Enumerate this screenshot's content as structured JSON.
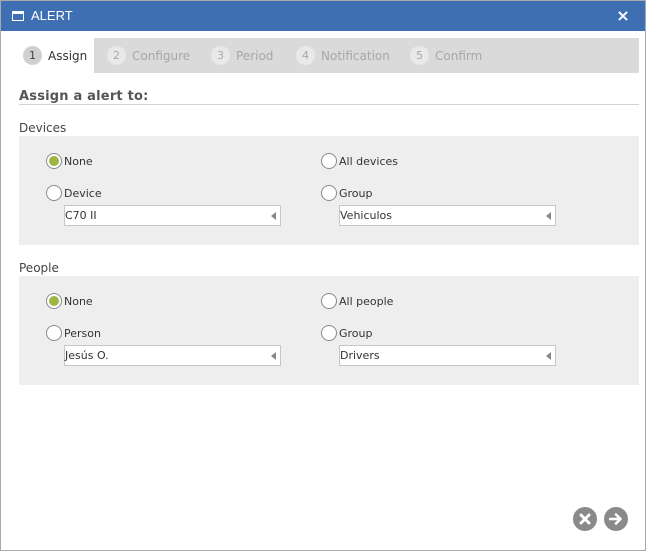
{
  "window": {
    "title": "ALERT",
    "icon": "window-icon",
    "close_icon": "close-icon",
    "close_glyph": "×"
  },
  "steps": [
    {
      "num": "1",
      "label": "Assign",
      "active": true
    },
    {
      "num": "2",
      "label": "Configure",
      "active": false
    },
    {
      "num": "3",
      "label": "Period",
      "active": false
    },
    {
      "num": "4",
      "label": "Notification",
      "active": false
    },
    {
      "num": "5",
      "label": "Confirm",
      "active": false
    }
  ],
  "heading": "Assign a alert to:",
  "devices": {
    "title": "Devices",
    "none_label": "None",
    "all_label": "All devices",
    "device_label": "Device",
    "group_label": "Group",
    "selected": "none",
    "device_value": "C70 II",
    "group_value": "Vehiculos"
  },
  "people": {
    "title": "People",
    "none_label": "None",
    "all_label": "All people",
    "person_label": "Person",
    "group_label": "Group",
    "selected": "none",
    "person_value": "Jesús O.",
    "group_value": "Drivers"
  },
  "footer": {
    "cancel_icon": "cancel-icon",
    "next_icon": "next-arrow-icon"
  },
  "colors": {
    "titlebar": "#3f6fb3",
    "radio_checked": "#9db542",
    "panel": "#eeeeee",
    "steps_bg": "#dadada"
  }
}
